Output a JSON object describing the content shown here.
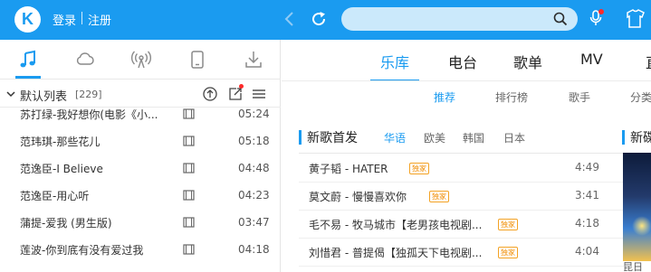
{
  "header": {
    "logo_letter": "K",
    "login": "登录",
    "register": "注册",
    "search_placeholder": ""
  },
  "colors": {
    "accent": "#1a9bf0",
    "topbar": "#1a9bf0",
    "badge": "#f08c00",
    "notification": "#ff2a2a"
  },
  "left_tabs": [
    {
      "name": "music-note-icon",
      "active": true
    },
    {
      "name": "cloud-icon",
      "active": false
    },
    {
      "name": "radio-icon",
      "active": false
    },
    {
      "name": "phone-icon",
      "active": false
    },
    {
      "name": "download-icon",
      "active": false
    }
  ],
  "playlist": {
    "title": "默认列表",
    "count": "[229]",
    "songs": [
      {
        "title": "苏打绿-我好想你(电影《小...",
        "time": "05:24"
      },
      {
        "title": "范玮琪-那些花儿",
        "time": "05:18"
      },
      {
        "title": "范逸臣-I Believe",
        "time": "04:48"
      },
      {
        "title": "范逸臣-用心听",
        "time": "04:23"
      },
      {
        "title": "蒲提-爱我 (男生版)",
        "time": "03:47"
      },
      {
        "title": "莲波-你到底有没有爱过我",
        "time": "04:18"
      }
    ]
  },
  "main_tabs": [
    "乐库",
    "电台",
    "歌单",
    "MV",
    "直"
  ],
  "sub_tabs": [
    "推荐",
    "排行榜",
    "歌手",
    "分类"
  ],
  "new_songs": {
    "title": "新歌首发",
    "languages": [
      "华语",
      "欧美",
      "韩国",
      "日本"
    ],
    "items": [
      {
        "title": "黄子韬 - HATER",
        "badge": "独家",
        "time": "4:49"
      },
      {
        "title": "莫文蔚 - 慢慢喜欢你",
        "badge": "独家",
        "time": "3:41"
      },
      {
        "title": "毛不易 - 牧马城市【老男孩电视剧...",
        "badge": "独家",
        "time": "4:18"
      },
      {
        "title": "刘惜君 - 普提偈【独孤天下电视剧...",
        "badge": "独家",
        "time": "4:04"
      }
    ]
  },
  "side_section": {
    "title": "新碟",
    "caption": "昆日"
  }
}
